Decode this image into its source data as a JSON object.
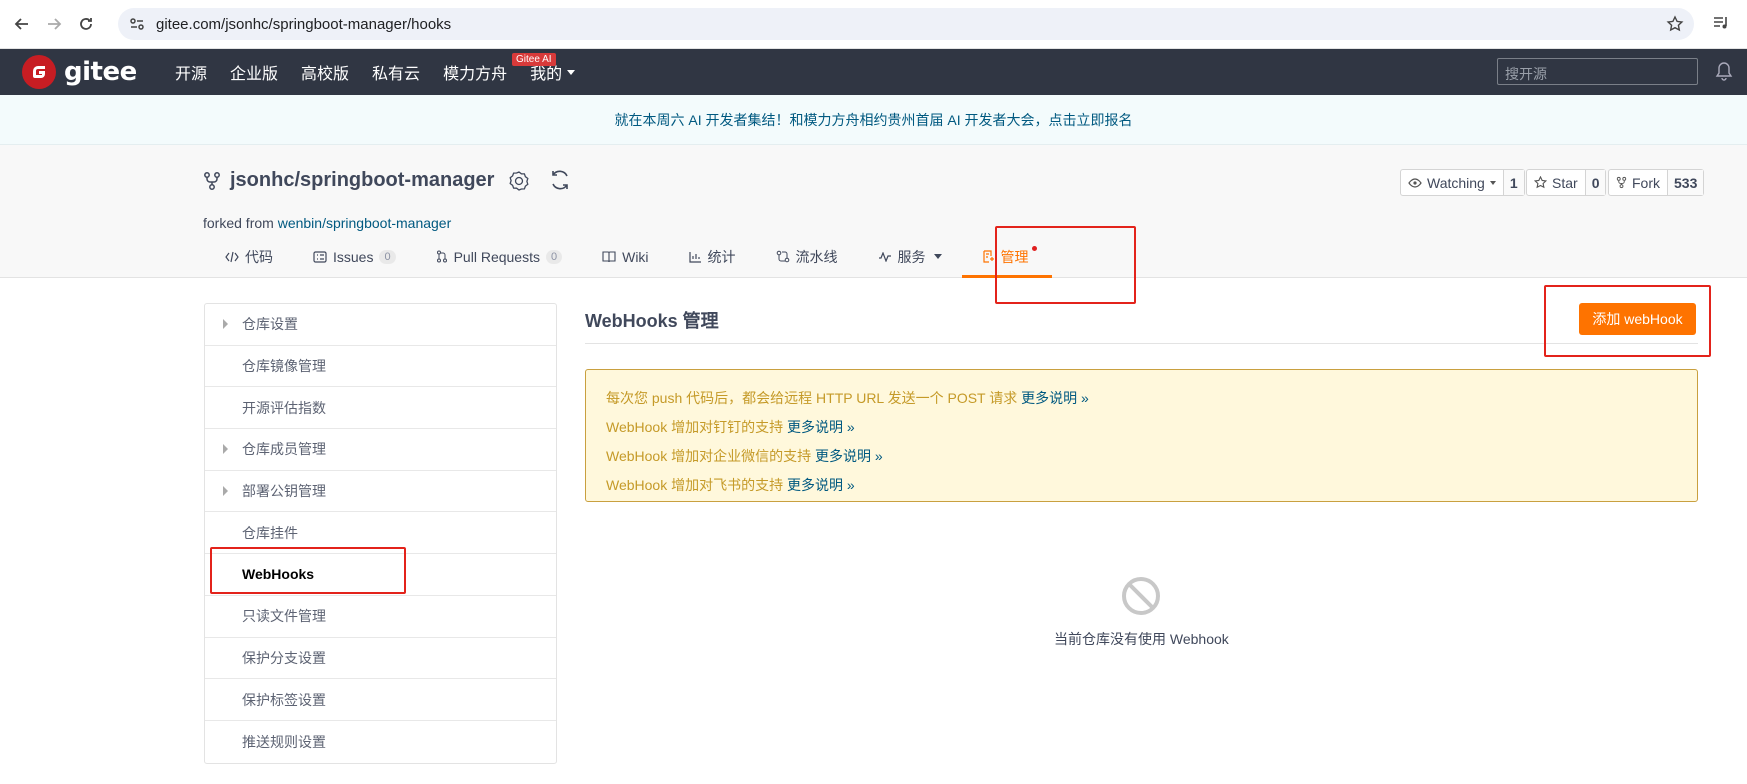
{
  "browser": {
    "url": "gitee.com/jsonhc/springboot-manager/hooks"
  },
  "header": {
    "logo_text": "gitee",
    "nav": [
      "开源",
      "企业版",
      "高校版",
      "私有云",
      "模力方舟",
      "我的"
    ],
    "ai_badge": "Gitee AI",
    "search_placeholder": "搜开源"
  },
  "banner": {
    "text": "就在本周六 AI 开发者集结！和模力方舟相约贵州首届 AI 开发者大会，点击立即报名"
  },
  "project": {
    "title": "jsonhc/springboot-manager",
    "forked_prefix": "forked from ",
    "forked_link": "wenbin/springboot-manager",
    "watching_label": "Watching",
    "watching_count": "1",
    "star_label": "Star",
    "star_count": "0",
    "fork_label": "Fork",
    "fork_count": "533"
  },
  "tabs": [
    {
      "label": "代码",
      "icon": "code-icon"
    },
    {
      "label": "Issues",
      "count": "0",
      "icon": "issues-icon"
    },
    {
      "label": "Pull Requests",
      "count": "0",
      "icon": "pull-request-icon"
    },
    {
      "label": "Wiki",
      "icon": "wiki-icon"
    },
    {
      "label": "统计",
      "icon": "chart-icon"
    },
    {
      "label": "流水线",
      "icon": "pipeline-icon"
    },
    {
      "label": "服务",
      "icon": "service-icon"
    },
    {
      "label": "管理",
      "icon": "manage-icon",
      "active": true
    }
  ],
  "sidebar": {
    "items": [
      {
        "label": "仓库设置",
        "expandable": true
      },
      {
        "label": "仓库镜像管理"
      },
      {
        "label": "开源评估指数"
      },
      {
        "label": "仓库成员管理",
        "expandable": true
      },
      {
        "label": "部署公钥管理",
        "expandable": true
      },
      {
        "label": "仓库挂件"
      },
      {
        "label": "WebHooks",
        "active": true
      },
      {
        "label": "只读文件管理"
      },
      {
        "label": "保护分支设置"
      },
      {
        "label": "保护标签设置"
      },
      {
        "label": "推送规则设置"
      }
    ]
  },
  "main": {
    "title": "WebHooks 管理",
    "add_button": "添加 webHook",
    "notices": [
      {
        "text": "每次您 push 代码后，都会给远程 HTTP URL 发送一个 POST 请求 ",
        "link": "更多说明 »"
      },
      {
        "text": "WebHook 增加对钉钉的支持 ",
        "link": "更多说明 »"
      },
      {
        "text": "WebHook 增加对企业微信的支持 ",
        "link": "更多说明 »"
      },
      {
        "text": "WebHook 增加对飞书的支持 ",
        "link": "更多说明 »"
      }
    ],
    "empty_text": "当前仓库没有使用 Webhook"
  },
  "colors": {
    "accent": "#fe7300",
    "header_bg": "#303643",
    "link": "#005980",
    "annotation": "#e3231b"
  }
}
